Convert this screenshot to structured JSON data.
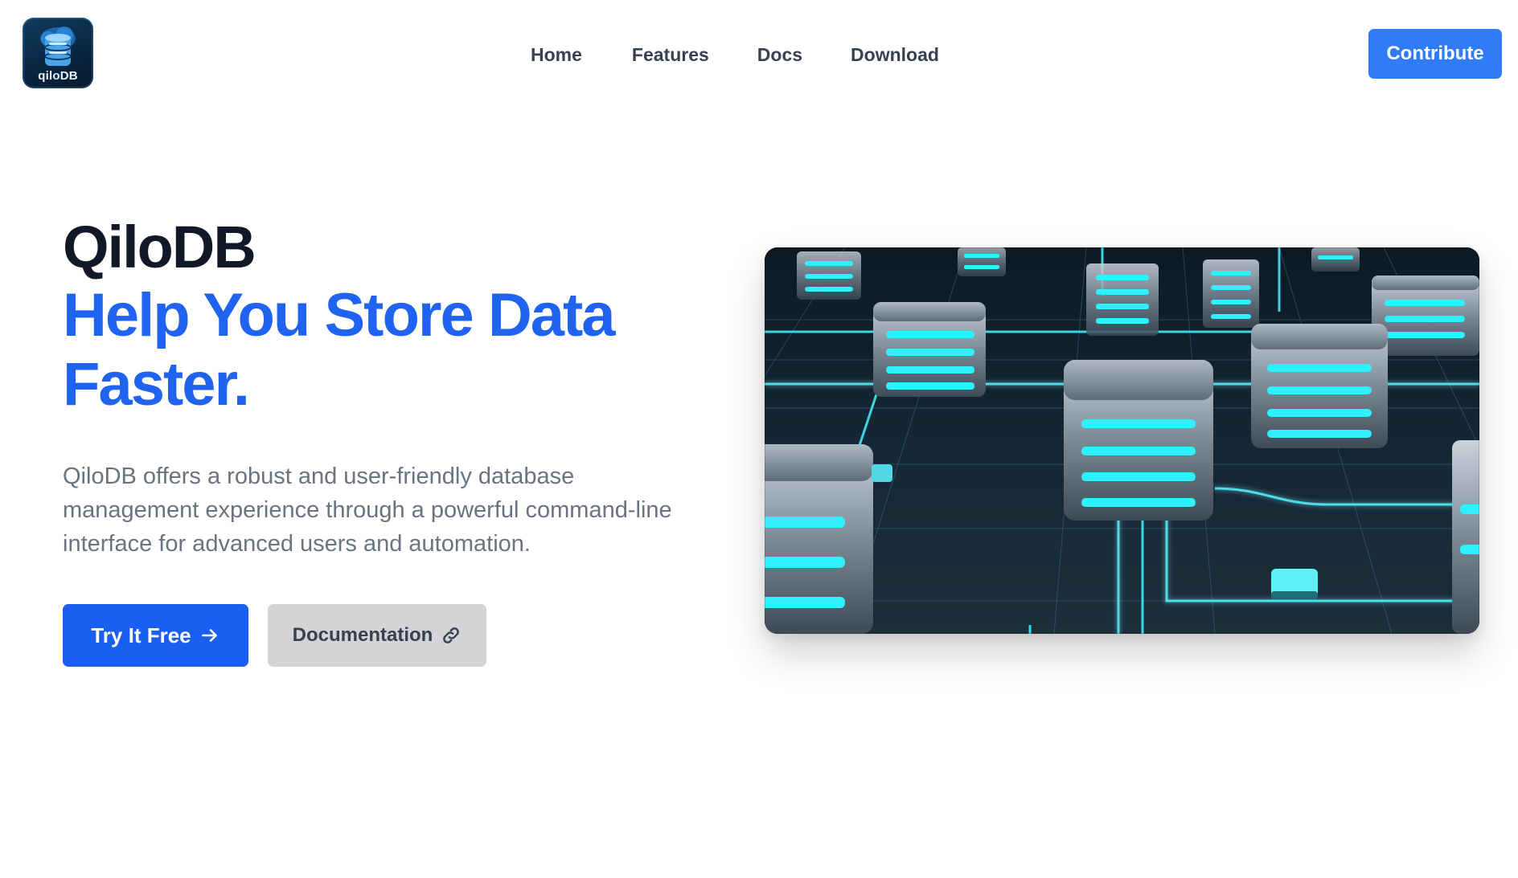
{
  "header": {
    "logo": {
      "text": "qiloDB",
      "icon": "database-cloud-icon"
    },
    "nav": [
      {
        "label": "Home"
      },
      {
        "label": "Features"
      },
      {
        "label": "Docs"
      },
      {
        "label": "Download"
      }
    ],
    "contribute_label": "Contribute"
  },
  "hero": {
    "title": "QiloDB",
    "tagline_line1": "Help You Store Data",
    "tagline_line2": "Faster.",
    "description": "QiloDB offers a robust and user-friendly database management experience through a powerful command-line interface for advanced users and automation.",
    "primary_button": {
      "label": "Try It Free",
      "icon": "arrow-right-icon"
    },
    "secondary_button": {
      "label": "Documentation",
      "icon": "link-icon"
    },
    "image": {
      "subject": "server-stacks-on-glowing-circuit-grid"
    }
  },
  "colors": {
    "primary": "#1a5ff2",
    "contribute": "#2f7cf6",
    "heading": "#111827",
    "body_text": "#6b7280",
    "secondary_button_bg": "#d4d4d6",
    "glow": "#25e3f0"
  }
}
